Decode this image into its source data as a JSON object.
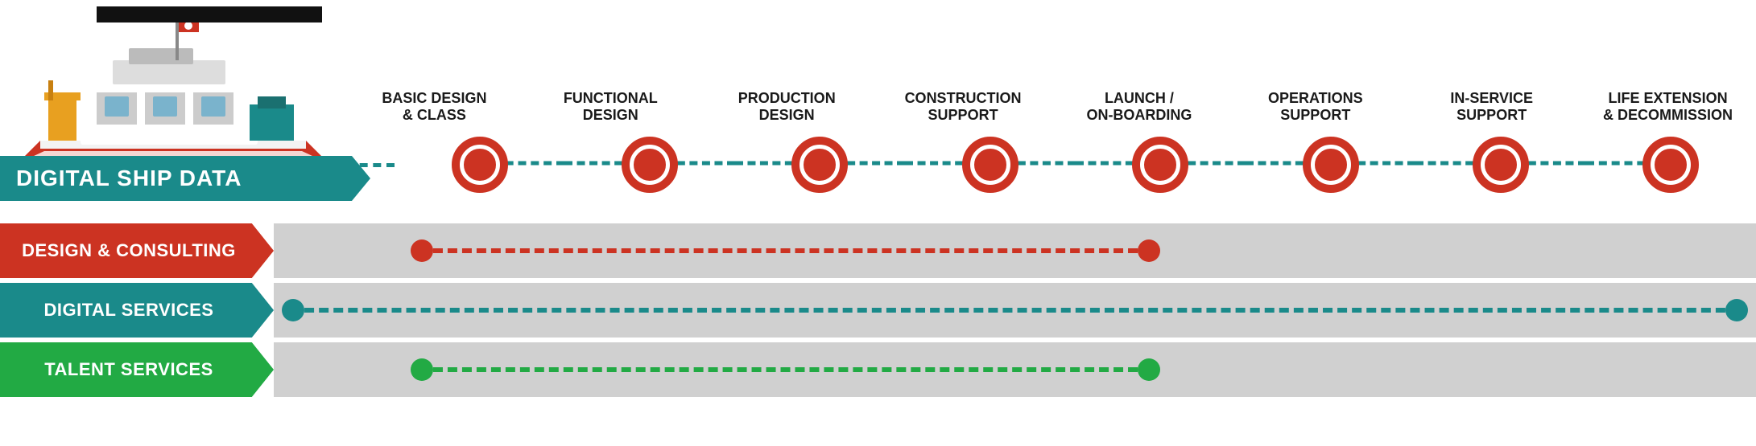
{
  "phases": [
    {
      "id": "basic-design",
      "label": "BASIC DESIGN\n& CLASS"
    },
    {
      "id": "functional-design",
      "label": "FUNCTIONAL\nDESIGN"
    },
    {
      "id": "production-design",
      "label": "PRODUCTION\nDESIGN"
    },
    {
      "id": "construction-support",
      "label": "CONSTRUCTION\nSUPPORT"
    },
    {
      "id": "launch-onboarding",
      "label": "LAUNCH /\nON-BOARDING"
    },
    {
      "id": "operations-support",
      "label": "OPERATIONS\nSUPPORT"
    },
    {
      "id": "in-service-support",
      "label": "IN-SERVICE\nSUPPORT"
    },
    {
      "id": "life-extension",
      "label": "LIFE EXTENSION\n& DECOMMISSION"
    }
  ],
  "digital_ship_data": {
    "label": "DIGITAL SHIP DATA"
  },
  "services": [
    {
      "id": "design-consulting",
      "label": "DESIGN & CONSULTING",
      "color_class": "design",
      "line_class": "design-line",
      "start_class": "design-start",
      "end_class": "design-end"
    },
    {
      "id": "digital-services",
      "label": "DIGITAL SERVICES",
      "color_class": "digital",
      "line_class": "digital-line",
      "start_class": "digital-start",
      "end_class": "digital-end"
    },
    {
      "id": "talent-services",
      "label": "TALENT SERVICES",
      "color_class": "talent",
      "line_class": "talent-line",
      "start_class": "talent-start",
      "end_class": "talent-end"
    }
  ]
}
